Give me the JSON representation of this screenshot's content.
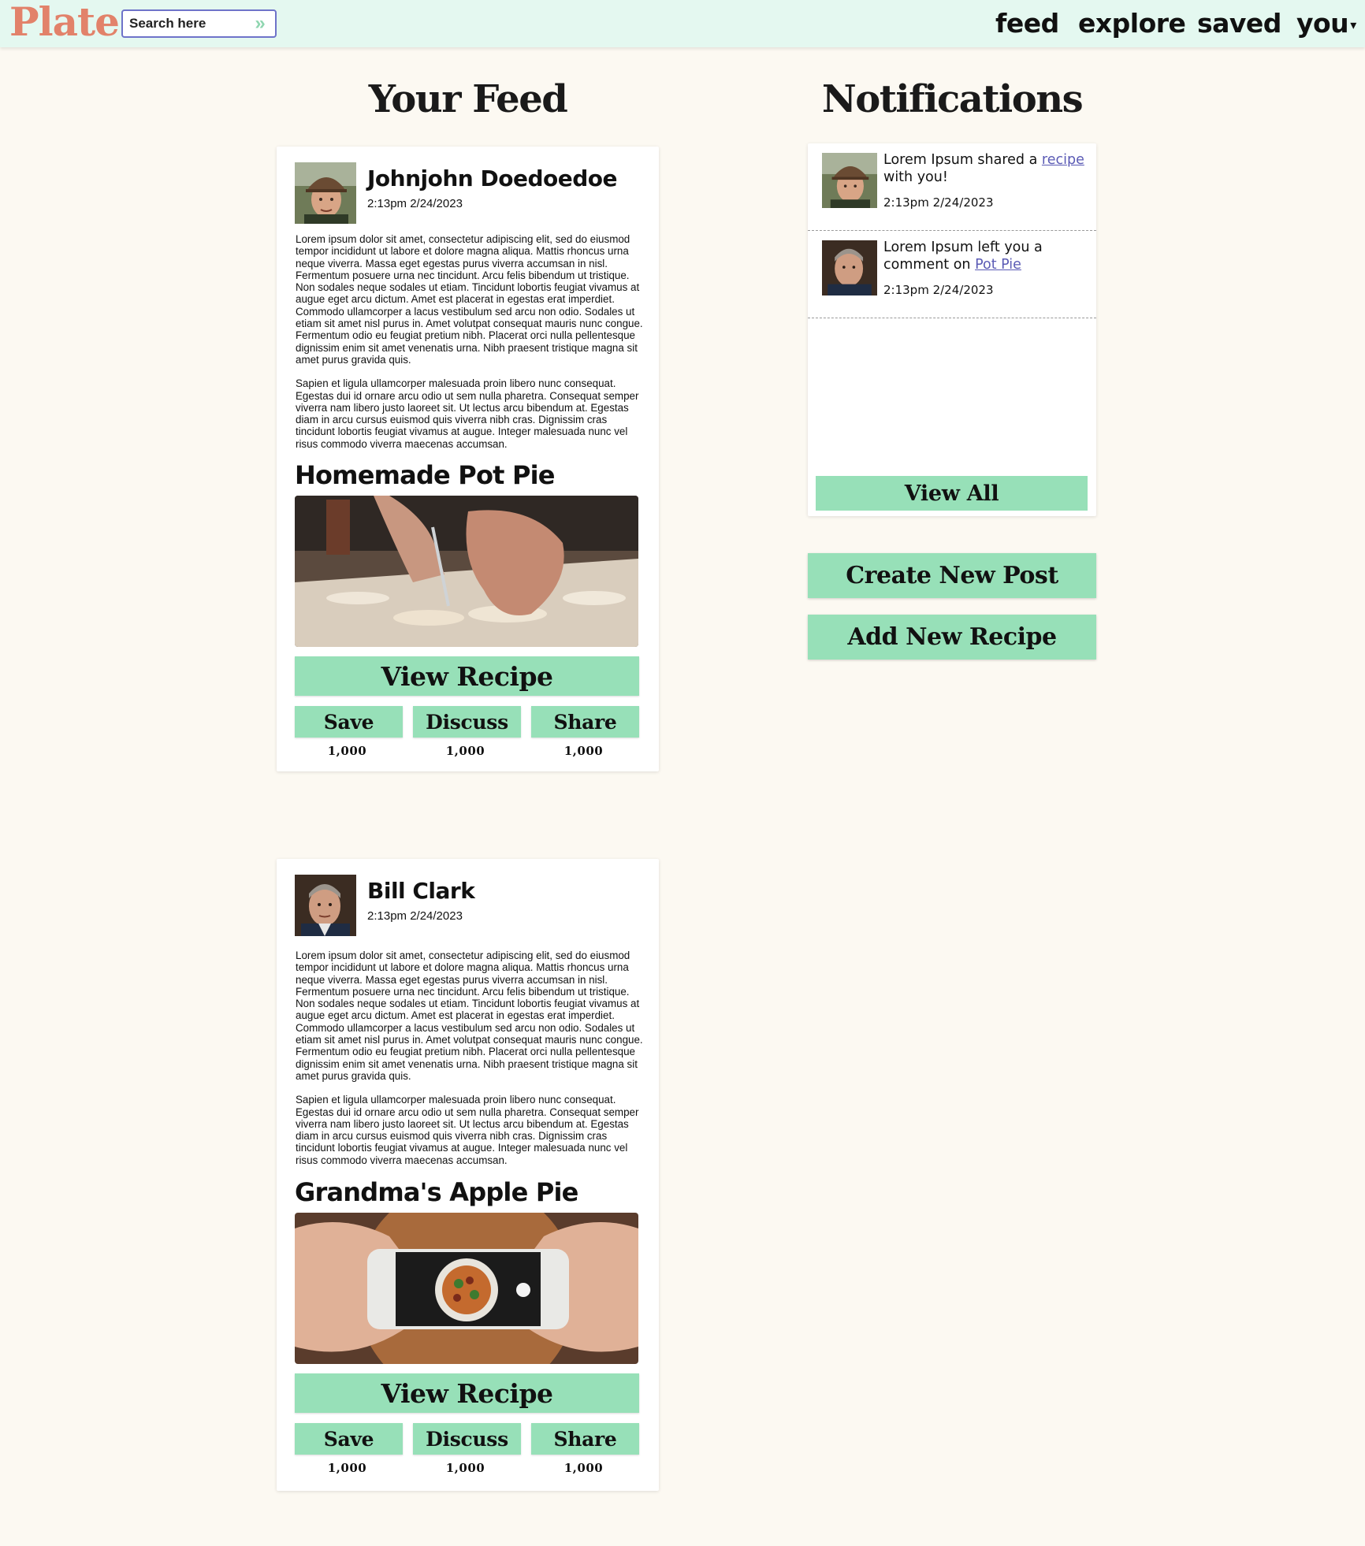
{
  "header": {
    "logo": "Plate",
    "search_placeholder": "Search here",
    "nav": [
      {
        "label": "feed"
      },
      {
        "label": "explore"
      },
      {
        "label": "saved"
      },
      {
        "label": "you"
      }
    ]
  },
  "feed": {
    "title": "Your Feed",
    "posts": [
      {
        "author": "Johnjohn Doedoedoe",
        "time": "2:13pm 2/24/2023",
        "body": [
          "Lorem ipsum dolor sit amet, consectetur adipiscing elit, sed do eiusmod tempor incididunt ut labore et dolore magna aliqua. Mattis rhoncus urna neque viverra. Massa eget egestas purus viverra accumsan in nisl. Fermentum posuere urna nec tincidunt. Arcu felis bibendum ut tristique. Non sodales neque sodales ut etiam. Tincidunt lobortis feugiat vivamus at augue eget arcu dictum. Amet est placerat in egestas erat imperdiet. Commodo ullamcorper a lacus vestibulum sed arcu non odio. Sodales ut etiam sit amet nisl purus in. Amet volutpat consequat mauris nunc congue. Fermentum odio eu feugiat pretium nibh. Placerat orci nulla pellentesque dignissim enim sit amet venenatis urna. Nibh praesent tristique magna sit amet purus gravida quis.",
          "Sapien et ligula ullamcorper malesuada proin libero nunc consequat. Egestas dui id ornare arcu odio ut sem nulla pharetra. Consequat semper viverra nam libero justo laoreet sit. Ut lectus arcu bibendum at. Egestas diam in arcu cursus euismod quis viverra nibh cras. Dignissim cras tincidunt lobortis feugiat vivamus at augue. Integer malesuada nunc vel risus commodo viverra maecenas accumsan."
        ],
        "recipe_title": "Homemade Pot Pie",
        "view_recipe": "View Recipe",
        "actions": [
          {
            "label": "Save",
            "count": "1,000"
          },
          {
            "label": "Discuss",
            "count": "1,000"
          },
          {
            "label": "Share",
            "count": "1,000"
          }
        ]
      },
      {
        "author": "Bill Clark",
        "time": "2:13pm 2/24/2023",
        "body": [
          "Lorem ipsum dolor sit amet, consectetur adipiscing elit, sed do eiusmod tempor incididunt ut labore et dolore magna aliqua. Mattis rhoncus urna neque viverra. Massa eget egestas purus viverra accumsan in nisl. Fermentum posuere urna nec tincidunt. Arcu felis bibendum ut tristique. Non sodales neque sodales ut etiam. Tincidunt lobortis feugiat vivamus at augue eget arcu dictum. Amet est placerat in egestas erat imperdiet. Commodo ullamcorper a lacus vestibulum sed arcu non odio. Sodales ut etiam sit amet nisl purus in. Amet volutpat consequat mauris nunc congue. Fermentum odio eu feugiat pretium nibh. Placerat orci nulla pellentesque dignissim enim sit amet venenatis urna. Nibh praesent tristique magna sit amet purus gravida quis.",
          "Sapien et ligula ullamcorper malesuada proin libero nunc consequat. Egestas dui id ornare arcu odio ut sem nulla pharetra. Consequat semper viverra nam libero justo laoreet sit. Ut lectus arcu bibendum at. Egestas diam in arcu cursus euismod quis viverra nibh cras. Dignissim cras tincidunt lobortis feugiat vivamus at augue. Integer malesuada nunc vel risus commodo viverra maecenas accumsan."
        ],
        "recipe_title": "Grandma's Apple Pie",
        "view_recipe": "View Recipe",
        "actions": [
          {
            "label": "Save",
            "count": "1,000"
          },
          {
            "label": "Discuss",
            "count": "1,000"
          },
          {
            "label": "Share",
            "count": "1,000"
          }
        ]
      }
    ]
  },
  "notifications": {
    "title": "Notifications",
    "items": [
      {
        "text_before": "Lorem Ipsum shared a ",
        "link": "recipe",
        "text_after": " with you!",
        "time": "2:13pm 2/24/2023"
      },
      {
        "text_before": "Lorem Ipsum left you a comment on ",
        "link": "Pot Pie",
        "text_after": "",
        "time": "2:13pm 2/24/2023"
      }
    ],
    "view_all": "View All"
  },
  "sidebar_actions": {
    "create_post": "Create New Post",
    "add_recipe": "Add New Recipe"
  },
  "colors": {
    "header_bg": "#e4f8f0",
    "page_bg": "#fcf9f2",
    "accent_button": "#97e0b8",
    "logo": "#e2826a",
    "link": "#5b5bb5"
  }
}
